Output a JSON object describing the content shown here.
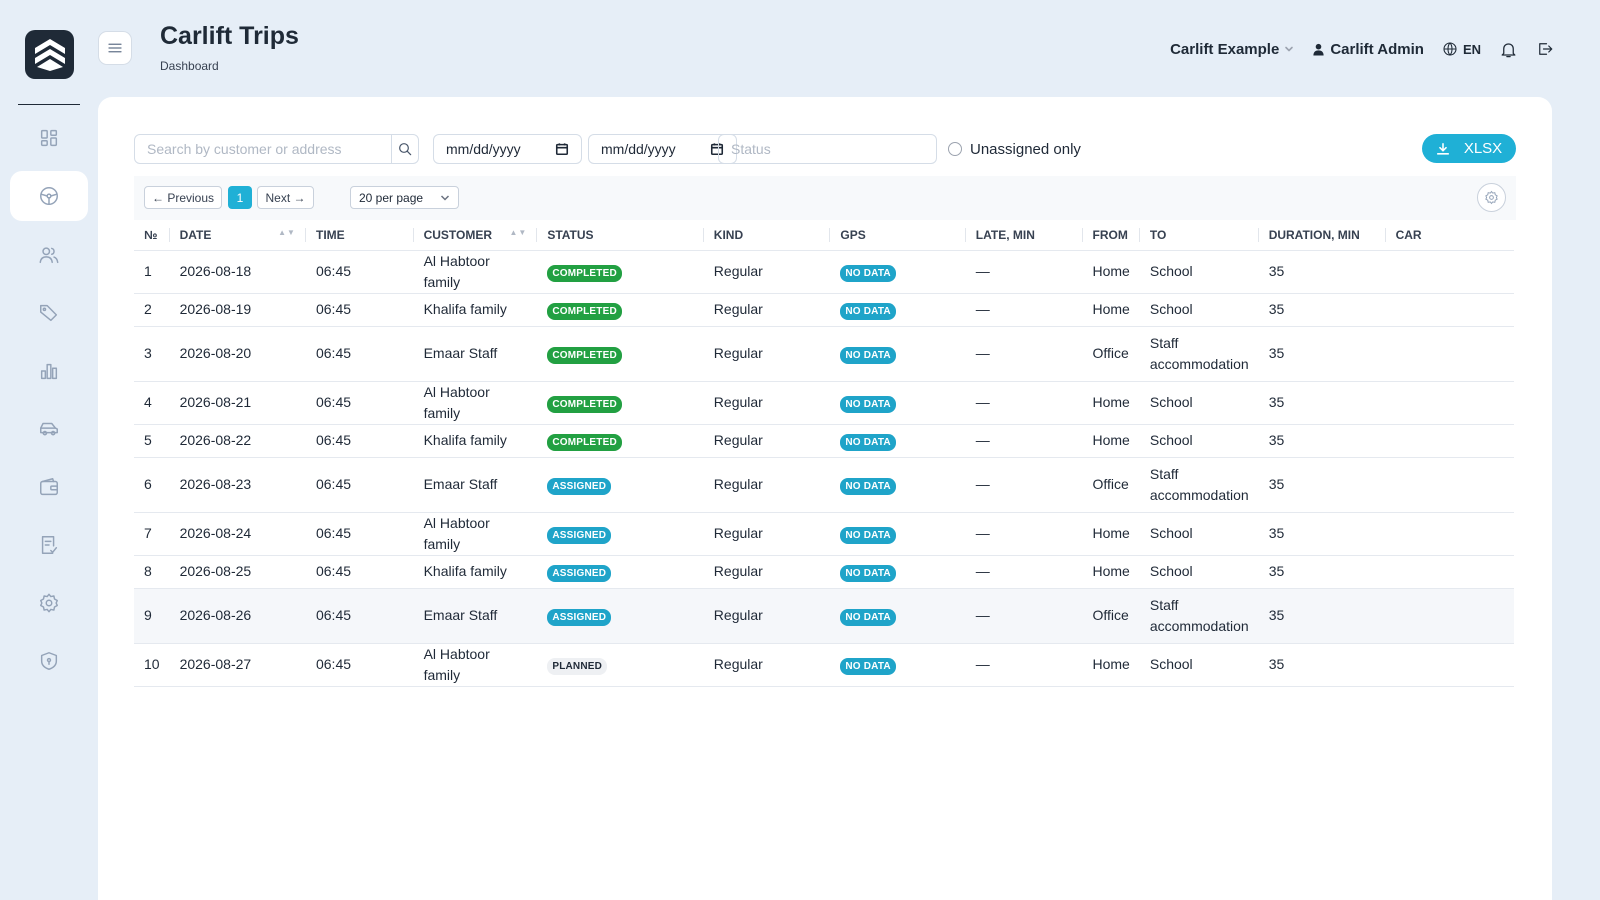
{
  "header": {
    "title": "Carlift Trips",
    "breadcrumb": "Dashboard",
    "company": "Carlift Example",
    "user": "Carlift Admin",
    "language": "EN"
  },
  "sidebar": {
    "items": [
      {
        "icon": "dashboard-icon",
        "active": false
      },
      {
        "icon": "steering-wheel-icon",
        "active": true
      },
      {
        "icon": "users-icon",
        "active": false
      },
      {
        "icon": "tag-icon",
        "active": false
      },
      {
        "icon": "bar-chart-icon",
        "active": false
      },
      {
        "icon": "car-icon",
        "active": false
      },
      {
        "icon": "wallet-icon",
        "active": false
      },
      {
        "icon": "checklist-icon",
        "active": false
      },
      {
        "icon": "gear-icon",
        "active": false
      },
      {
        "icon": "shield-icon",
        "active": false
      }
    ]
  },
  "filters": {
    "search_placeholder": "Search by customer or address",
    "date_from": "mm/dd/yyyy",
    "date_to": "mm/dd/yyyy",
    "status_placeholder": "Status",
    "unassigned_label": "Unassigned only",
    "export_label": "XLSX"
  },
  "pager": {
    "previous": "← Previous",
    "current": "1",
    "next": "Next →",
    "per_page": "20 per page"
  },
  "table": {
    "columns": [
      "№",
      "DATE",
      "TIME",
      "CUSTOMER",
      "STATUS",
      "KIND",
      "GPS",
      "LATE, MIN",
      "FROM",
      "TO",
      "DURATION, MIN",
      "CAR"
    ],
    "rows": [
      {
        "n": "1",
        "date": "2026-08-18",
        "time": "06:45",
        "customer": "Al Habtoor family",
        "status": "COMPLETED",
        "kind": "Regular",
        "gps": "NO DATA",
        "late": "—",
        "from": "Home",
        "to": "School",
        "duration": "35",
        "car": ""
      },
      {
        "n": "2",
        "date": "2026-08-19",
        "time": "06:45",
        "customer": "Khalifa family",
        "status": "COMPLETED",
        "kind": "Regular",
        "gps": "NO DATA",
        "late": "—",
        "from": "Home",
        "to": "School",
        "duration": "35",
        "car": ""
      },
      {
        "n": "3",
        "date": "2026-08-20",
        "time": "06:45",
        "customer": "Emaar Staff",
        "status": "COMPLETED",
        "kind": "Regular",
        "gps": "NO DATA",
        "late": "—",
        "from": "Office",
        "to": "Staff accommodation",
        "duration": "35",
        "car": ""
      },
      {
        "n": "4",
        "date": "2026-08-21",
        "time": "06:45",
        "customer": "Al Habtoor family",
        "status": "COMPLETED",
        "kind": "Regular",
        "gps": "NO DATA",
        "late": "—",
        "from": "Home",
        "to": "School",
        "duration": "35",
        "car": ""
      },
      {
        "n": "5",
        "date": "2026-08-22",
        "time": "06:45",
        "customer": "Khalifa family",
        "status": "COMPLETED",
        "kind": "Regular",
        "gps": "NO DATA",
        "late": "—",
        "from": "Home",
        "to": "School",
        "duration": "35",
        "car": ""
      },
      {
        "n": "6",
        "date": "2026-08-23",
        "time": "06:45",
        "customer": "Emaar Staff",
        "status": "ASSIGNED",
        "kind": "Regular",
        "gps": "NO DATA",
        "late": "—",
        "from": "Office",
        "to": "Staff accommodation",
        "duration": "35",
        "car": ""
      },
      {
        "n": "7",
        "date": "2026-08-24",
        "time": "06:45",
        "customer": "Al Habtoor family",
        "status": "ASSIGNED",
        "kind": "Regular",
        "gps": "NO DATA",
        "late": "—",
        "from": "Home",
        "to": "School",
        "duration": "35",
        "car": ""
      },
      {
        "n": "8",
        "date": "2026-08-25",
        "time": "06:45",
        "customer": "Khalifa family",
        "status": "ASSIGNED",
        "kind": "Regular",
        "gps": "NO DATA",
        "late": "—",
        "from": "Home",
        "to": "School",
        "duration": "35",
        "car": ""
      },
      {
        "n": "9",
        "date": "2026-08-26",
        "time": "06:45",
        "customer": "Emaar Staff",
        "status": "ASSIGNED",
        "kind": "Regular",
        "gps": "NO DATA",
        "late": "—",
        "from": "Office",
        "to": "Staff accommodation",
        "duration": "35",
        "car": "",
        "highlighted": true
      },
      {
        "n": "10",
        "date": "2026-08-27",
        "time": "06:45",
        "customer": "Al Habtoor family",
        "status": "PLANNED",
        "kind": "Regular",
        "gps": "NO DATA",
        "late": "—",
        "from": "Home",
        "to": "School",
        "duration": "35",
        "car": ""
      }
    ]
  },
  "colors": {
    "accent": "#1fb0d6",
    "completed": "#22a042",
    "assigned": "#1fa4c9",
    "background": "#e6eef7"
  }
}
